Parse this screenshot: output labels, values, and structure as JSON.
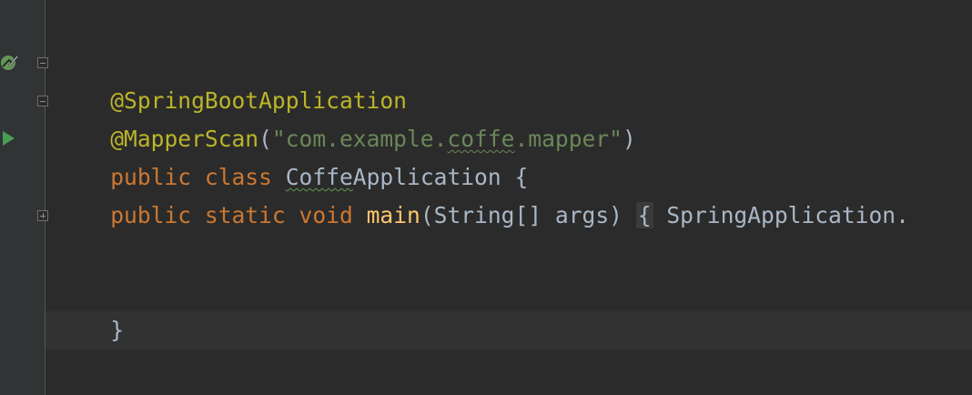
{
  "editor": {
    "line1": {
      "annotation": "@SpringBootApplication"
    },
    "line2": {
      "annotation": "@MapperScan",
      "open_paren": "(",
      "string_start": "\"com.example.",
      "string_typo": "coffe",
      "string_end": ".mapper\"",
      "close_paren": ")"
    },
    "line3": {
      "kw_public": "public",
      "kw_class": "class",
      "class_name_typo": "Coffe",
      "class_name_rest": "Application",
      "brace": "{"
    },
    "line4": {
      "kw_public": "public",
      "kw_static": "static",
      "kw_void": "void",
      "method": "main",
      "params": "(String[] args)",
      "fold_brace": "{",
      "body": "SpringApplication."
    },
    "line5": {
      "brace": "}"
    }
  },
  "gutter": {
    "icons": [
      "spring-bean-icon",
      "run-icon",
      "fold-minus-icon",
      "fold-plus-icon"
    ]
  },
  "colors": {
    "background": "#2b2b2b",
    "gutter": "#313335",
    "annotation": "#bbb529",
    "keyword": "#cc7832",
    "string": "#6a8759",
    "method": "#ffc66d",
    "text": "#a9b7c6",
    "run": "#499c54"
  }
}
